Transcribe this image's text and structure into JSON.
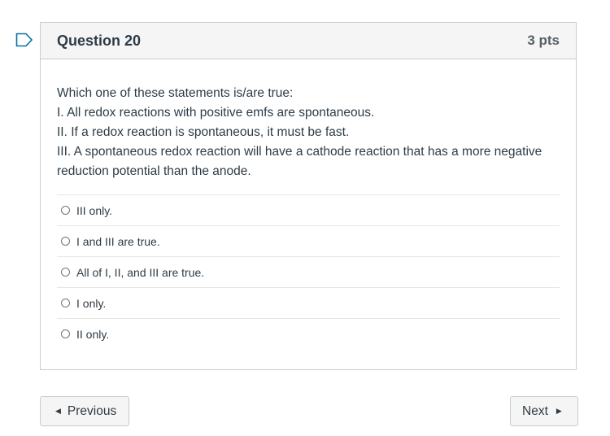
{
  "question": {
    "title": "Question 20",
    "points": "3 pts",
    "text_lines": [
      "Which one of these statements is/are true:",
      "I. All redox reactions with positive emfs are spontaneous.",
      "II. If a redox reaction is spontaneous, it must be fast.",
      "III. A spontaneous redox reaction will have a cathode reaction that has a more negative reduction potential than the anode."
    ],
    "answers": [
      {
        "label": "III only."
      },
      {
        "label": "I and III are true."
      },
      {
        "label": "All of I, II, and III are true."
      },
      {
        "label": "I only."
      },
      {
        "label": "II only."
      }
    ]
  },
  "navigation": {
    "previous_label": "Previous",
    "next_label": "Next"
  },
  "icons": {
    "flag": "flag-outline-icon",
    "prev_caret": "caret-left-icon",
    "next_caret": "caret-right-icon"
  },
  "colors": {
    "flag_blue": "#0770a3",
    "text": "#2d3b45",
    "header_bg": "#f5f5f5",
    "border": "#c7cdd1"
  }
}
